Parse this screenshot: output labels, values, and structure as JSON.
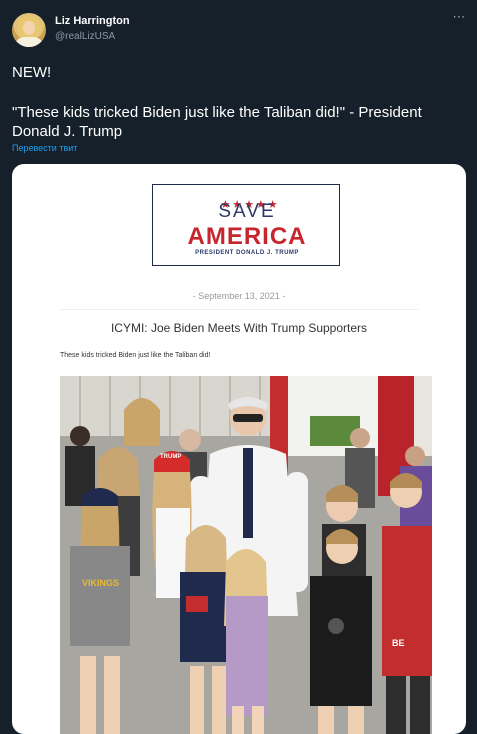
{
  "author": {
    "display_name": "Liz Harrington",
    "handle": "@realLizUSA"
  },
  "tweet": {
    "line1": "NEW!",
    "line2": "\"These kids tricked Biden just like the Taliban did!\" - President Donald J. Trump",
    "translate_label": "Перевести твит",
    "more_icon": "⋯"
  },
  "card": {
    "logo": {
      "stars": "★★★★★",
      "save": "SAVE",
      "america": "AMERICA",
      "president": "PRESIDENT DONALD J. TRUMP"
    },
    "date": "- September 13, 2021 -",
    "headline": "ICYMI: Joe Biden Meets With Trump Supporters",
    "subhead": "These kids tricked Biden just like the Taliban did!",
    "photo": {
      "hat_text": "TRUMP"
    }
  },
  "colors": {
    "background": "#15202b",
    "accent": "#1da1f2",
    "logo_red": "#c7262f",
    "logo_navy": "#2c3a67"
  }
}
